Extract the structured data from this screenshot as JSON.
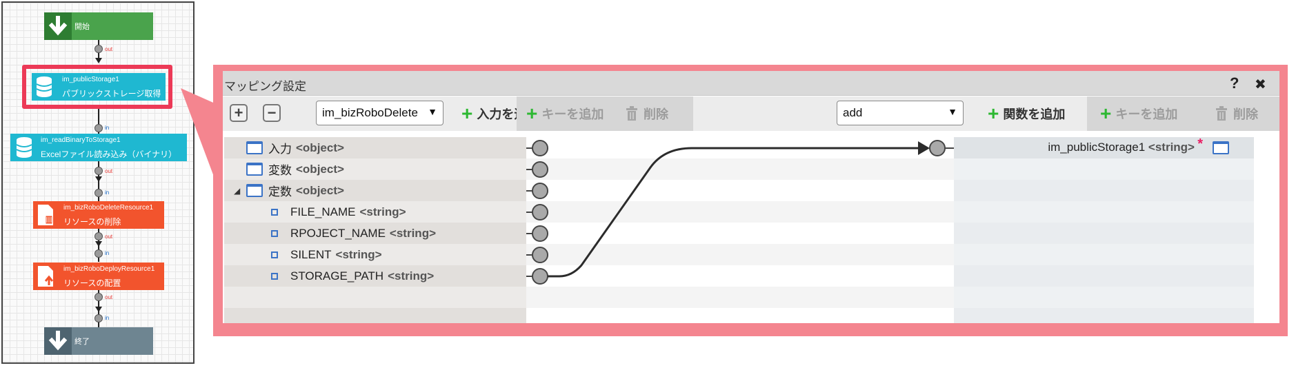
{
  "flow": {
    "start": {
      "label": "開始",
      "color": "#4aa34c"
    },
    "nodes": [
      {
        "title": "im_publicStorage1",
        "subtitle": "パブリックストレージ取得",
        "color": "#1fb8d1",
        "icon": "database-icon"
      },
      {
        "title": "im_readBinaryToStorage1",
        "subtitle": "Excelファイル読み込み（バイナリ）",
        "color": "#1fb8d1",
        "icon": "database-icon"
      },
      {
        "title": "im_bizRoboDeleteResource1",
        "subtitle": "リソースの削除",
        "color": "#f2542d",
        "icon": "document-delete-icon"
      },
      {
        "title": "im_bizRoboDeployResource1",
        "subtitle": "リソースの配置",
        "color": "#f2542d",
        "icon": "document-deploy-icon"
      }
    ],
    "end": {
      "label": "終了",
      "color": "#6e8591"
    },
    "port_out": "out",
    "port_in": "in"
  },
  "dialog": {
    "title": "マッピング設定",
    "help_label": "?",
    "close_label": "✖",
    "toolbar": {
      "expand_label": "+",
      "collapse_label": "−",
      "source_select_value": "im_bizRoboDelete",
      "add_input_label": "入力を追加",
      "add_key_left_label": "キーを追加",
      "delete_left_label": "削除",
      "function_select_value": "add",
      "add_function_label": "関数を追加",
      "add_key_right_label": "キーを追加",
      "delete_right_label": "削除"
    },
    "left_tree": [
      {
        "name": "入力",
        "type": "<object>",
        "kind": "object",
        "indent": 0
      },
      {
        "name": "変数",
        "type": "<object>",
        "kind": "object",
        "indent": 0
      },
      {
        "name": "定数",
        "type": "<object>",
        "kind": "object",
        "indent": 0,
        "expanded": true
      },
      {
        "name": "FILE_NAME",
        "type": "<string>",
        "kind": "leaf",
        "indent": 1
      },
      {
        "name": "RPOJECT_NAME",
        "type": "<string>",
        "kind": "leaf",
        "indent": 1
      },
      {
        "name": "SILENT",
        "type": "<string>",
        "kind": "leaf",
        "indent": 1
      },
      {
        "name": "STORAGE_PATH",
        "type": "<string>",
        "kind": "leaf",
        "indent": 1
      }
    ],
    "right_tree": [
      {
        "name": "im_publicStorage1",
        "type": "<string>",
        "required_mark": "*"
      }
    ],
    "mapping": {
      "from": "STORAGE_PATH",
      "to": "im_publicStorage1"
    }
  }
}
